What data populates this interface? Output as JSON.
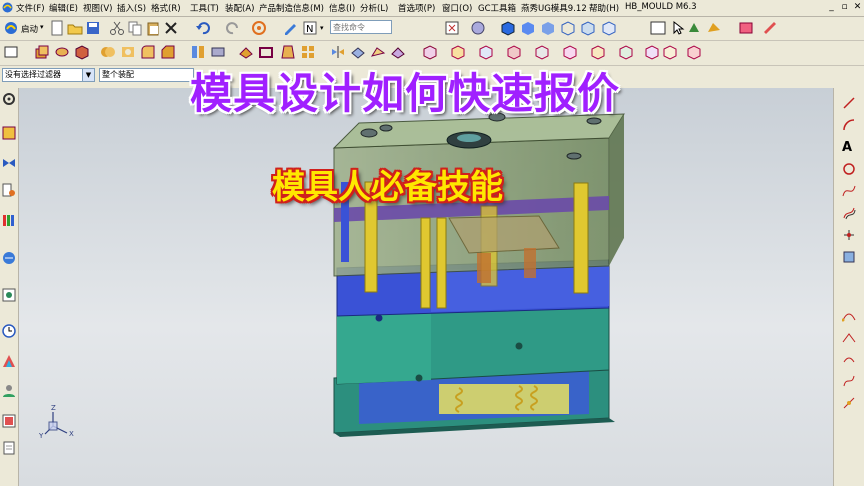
{
  "menu": {
    "items": [
      "文件(F)",
      "编辑(E)",
      "视图(V)",
      "插入(S)",
      "格式(R)",
      "工具(T)",
      "装配(A)",
      "产品制造信息(M)",
      "信息(I)",
      "分析(L)",
      "首选项(P)",
      "窗口(O)",
      "GC工具箱",
      "燕秀UG模具9.12",
      "帮助(H)",
      "HB_MOULD M6.3"
    ]
  },
  "toolbar": {
    "start_label": "启动",
    "search_placeholder": "查找命令"
  },
  "selection": {
    "filter_value": "没有选择过滤器",
    "scope_value": "整个装配"
  },
  "overlay": {
    "title": "模具设计如何快速报价",
    "subtitle": "模具人必备技能"
  },
  "icons": {
    "window_controls": [
      "minimize-icon",
      "restore-icon",
      "close-icon"
    ]
  },
  "colors": {
    "title": "#a020ff",
    "subtitle": "#ffe800",
    "subtitle_outline": "#d0201c",
    "mold_plate_blue": "#3a52d6",
    "mold_plate_teal": "#2f9a86",
    "mold_translucent_green": "#8aa86a"
  }
}
